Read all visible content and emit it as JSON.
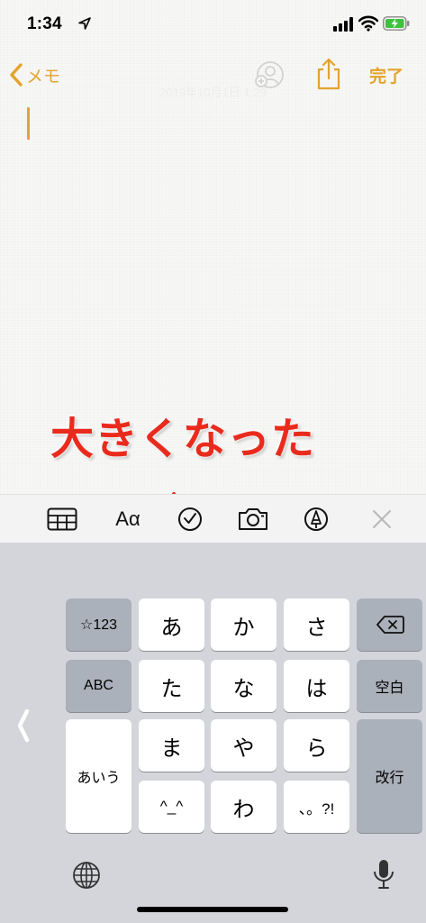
{
  "status_bar": {
    "time": "1:34"
  },
  "nav": {
    "back_label": "メモ",
    "date": "2019年10月1日 1:29",
    "done_label": "完了"
  },
  "annotation": {
    "text": "大きくなった"
  },
  "toolbar": {
    "format_label": "Aα"
  },
  "keyboard": {
    "keys": {
      "symbols": "☆123",
      "abc": "ABC",
      "aiu": "あいう",
      "a": "あ",
      "ka": "か",
      "sa": "さ",
      "ta": "た",
      "na": "な",
      "ha": "は",
      "ma": "ま",
      "ya": "や",
      "ra": "ら",
      "kaomoji": "^_^",
      "wa": "わ",
      "punct": "、。?!",
      "space": "空白",
      "return": "改行"
    }
  },
  "colors": {
    "accent": "#e3a32b",
    "annotation": "#e92b1d",
    "keyboard_bg": "#d3d5db"
  }
}
